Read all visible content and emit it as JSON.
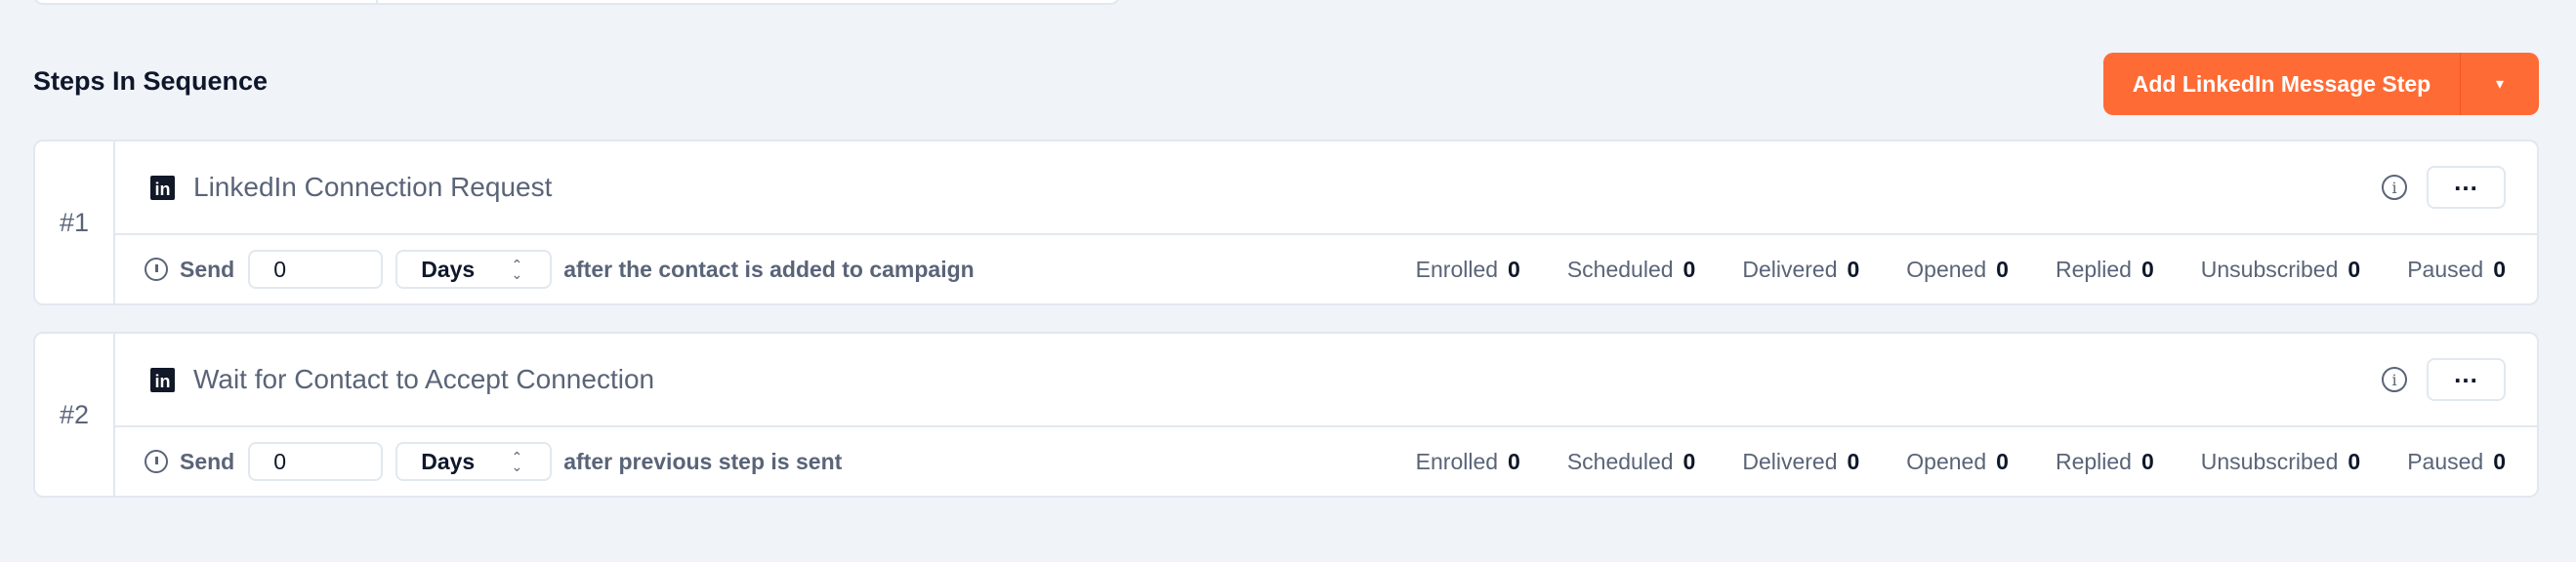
{
  "section_title": "Steps In Sequence",
  "add_button": {
    "label": "Add LinkedIn Message Step",
    "caret": "▾",
    "color": "#ff6b35"
  },
  "steps": [
    {
      "number": "#1",
      "title": "LinkedIn Connection Request",
      "icon": "linkedin-icon",
      "send_label": "Send",
      "delay_value": "0",
      "delay_unit": "Days",
      "after_text": "after the contact is added to campaign",
      "stats": [
        {
          "label": "Enrolled",
          "value": "0"
        },
        {
          "label": "Scheduled",
          "value": "0"
        },
        {
          "label": "Delivered",
          "value": "0"
        },
        {
          "label": "Opened",
          "value": "0"
        },
        {
          "label": "Replied",
          "value": "0"
        },
        {
          "label": "Unsubscribed",
          "value": "0"
        },
        {
          "label": "Paused",
          "value": "0"
        }
      ]
    },
    {
      "number": "#2",
      "title": "Wait for Contact to Accept Connection",
      "icon": "linkedin-icon",
      "send_label": "Send",
      "delay_value": "0",
      "delay_unit": "Days",
      "after_text": "after previous step is sent",
      "stats": [
        {
          "label": "Enrolled",
          "value": "0"
        },
        {
          "label": "Scheduled",
          "value": "0"
        },
        {
          "label": "Delivered",
          "value": "0"
        },
        {
          "label": "Opened",
          "value": "0"
        },
        {
          "label": "Replied",
          "value": "0"
        },
        {
          "label": "Unsubscribed",
          "value": "0"
        },
        {
          "label": "Paused",
          "value": "0"
        }
      ]
    }
  ]
}
